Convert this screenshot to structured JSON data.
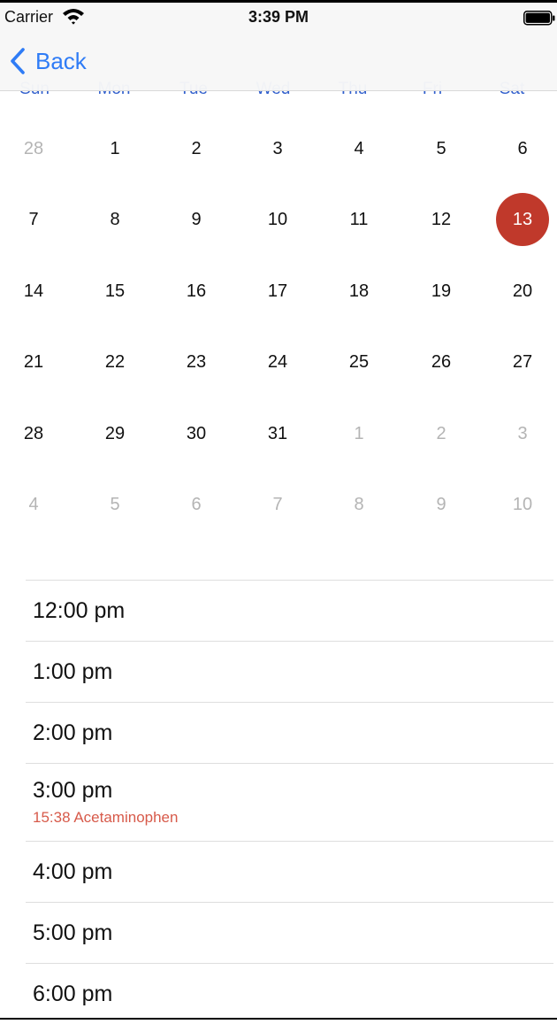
{
  "status_bar": {
    "carrier": "Carrier",
    "time": "3:39 PM",
    "icons": [
      "wifi-icon",
      "battery-icon"
    ]
  },
  "nav": {
    "back_label": "Back",
    "accent_color": "#2f7cf6"
  },
  "calendar": {
    "weekdays": [
      "Sun",
      "Mon",
      "Tue",
      "Wed",
      "Thu",
      "Fri",
      "Sat"
    ],
    "selected_day": "13",
    "selected_color": "#c0392b",
    "weeks": [
      [
        {
          "d": "28",
          "m": true
        },
        {
          "d": "1"
        },
        {
          "d": "2"
        },
        {
          "d": "3"
        },
        {
          "d": "4"
        },
        {
          "d": "5"
        },
        {
          "d": "6"
        }
      ],
      [
        {
          "d": "7"
        },
        {
          "d": "8"
        },
        {
          "d": "9"
        },
        {
          "d": "10"
        },
        {
          "d": "11"
        },
        {
          "d": "12"
        },
        {
          "d": "13",
          "s": true
        }
      ],
      [
        {
          "d": "14"
        },
        {
          "d": "15"
        },
        {
          "d": "16"
        },
        {
          "d": "17"
        },
        {
          "d": "18"
        },
        {
          "d": "19"
        },
        {
          "d": "20"
        }
      ],
      [
        {
          "d": "21"
        },
        {
          "d": "22"
        },
        {
          "d": "23"
        },
        {
          "d": "24"
        },
        {
          "d": "25"
        },
        {
          "d": "26"
        },
        {
          "d": "27"
        }
      ],
      [
        {
          "d": "28"
        },
        {
          "d": "29"
        },
        {
          "d": "30"
        },
        {
          "d": "31"
        },
        {
          "d": "1",
          "m": true
        },
        {
          "d": "2",
          "m": true
        },
        {
          "d": "3",
          "m": true
        }
      ],
      [
        {
          "d": "4",
          "m": true
        },
        {
          "d": "5",
          "m": true
        },
        {
          "d": "6",
          "m": true
        },
        {
          "d": "7",
          "m": true
        },
        {
          "d": "8",
          "m": true
        },
        {
          "d": "9",
          "m": true
        },
        {
          "d": "10",
          "m": true
        }
      ]
    ]
  },
  "hours": [
    {
      "label": "12:00 pm"
    },
    {
      "label": "1:00 pm"
    },
    {
      "label": "2:00 pm"
    },
    {
      "label": "3:00 pm",
      "event": "15:38 Acetaminophen"
    },
    {
      "label": "4:00 pm"
    },
    {
      "label": "5:00 pm"
    },
    {
      "label": "6:00 pm"
    }
  ],
  "event_color": "#d75a4a"
}
